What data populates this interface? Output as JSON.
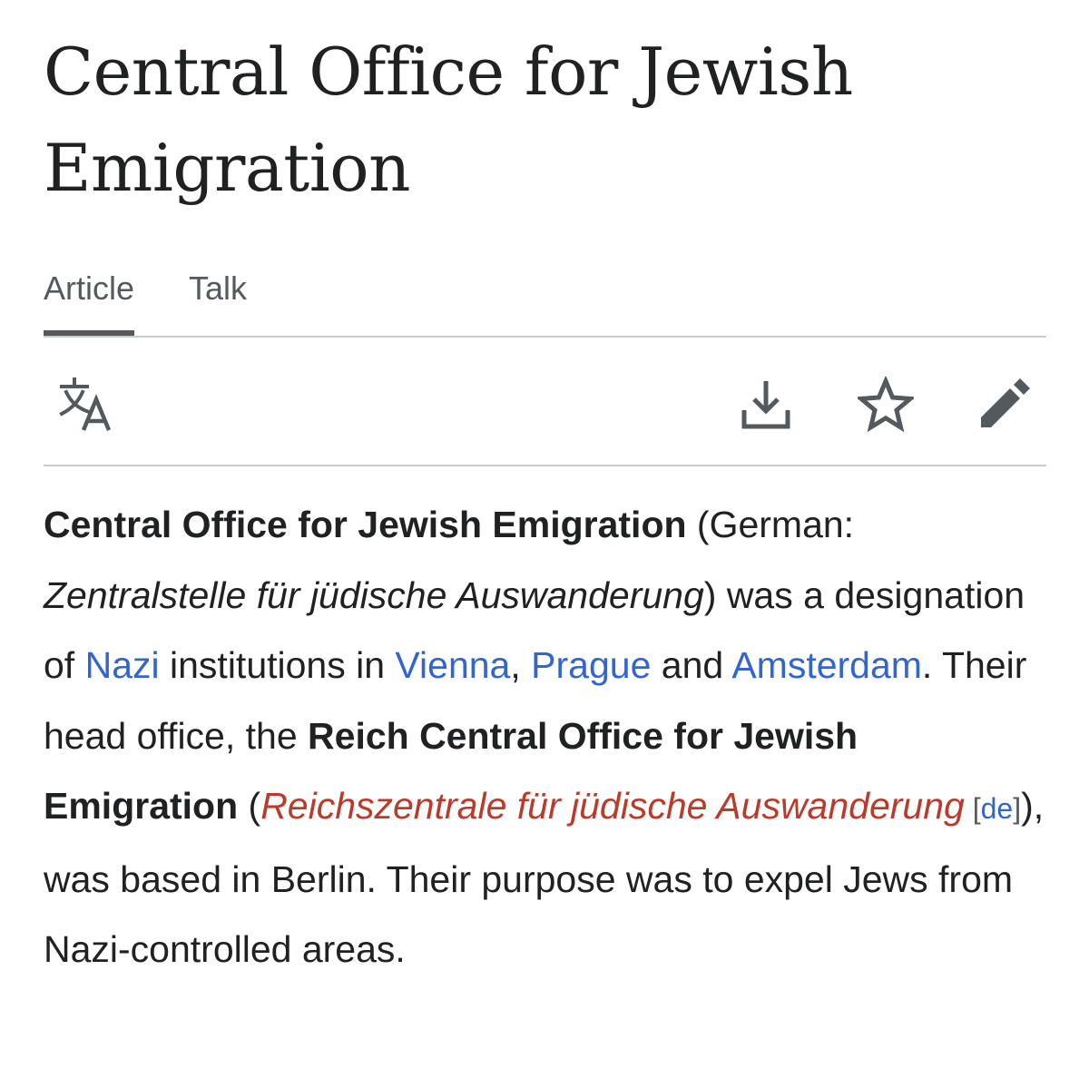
{
  "page": {
    "title_line1": "Central Office for Jewish",
    "title_line2": "Emigration"
  },
  "tabs": {
    "article": "Article",
    "talk": "Talk"
  },
  "toolbar": {
    "language_icon": "language-icon",
    "download_icon": "download-icon",
    "watch_icon": "star-icon",
    "edit_icon": "pencil-icon"
  },
  "article": {
    "lead_bold": "Central Office for Jewish Emigration",
    "german_open": " (German: ",
    "german_name": "Zentralstelle für jüdische Auswanderung",
    "was_a": ") was a designation of ",
    "link_nazi": "Nazi",
    "institutions_in": " institutions in ",
    "link_vienna": "Vienna",
    "comma": ", ",
    "link_prague": "Prague",
    "and": " and ",
    "link_amsterdam": "Amsterdam",
    "head_office": ". Their head office, the ",
    "reich_bold": "Reich Central Office for Jewish Emigration",
    "paren_open": " (",
    "redlink_name": "Reichszentrale für jüdische Auswanderung",
    "interlang_open": " [",
    "interlang_code": "de",
    "interlang_close": "]",
    "based": "), was based in Berlin. Their purpose was to expel Jews from Nazi-controlled areas."
  },
  "colors": {
    "link": "#3366cc",
    "redlink": "#ba3a2c",
    "text": "#202122",
    "muted": "#54595d",
    "divider": "#c8ccd1"
  }
}
